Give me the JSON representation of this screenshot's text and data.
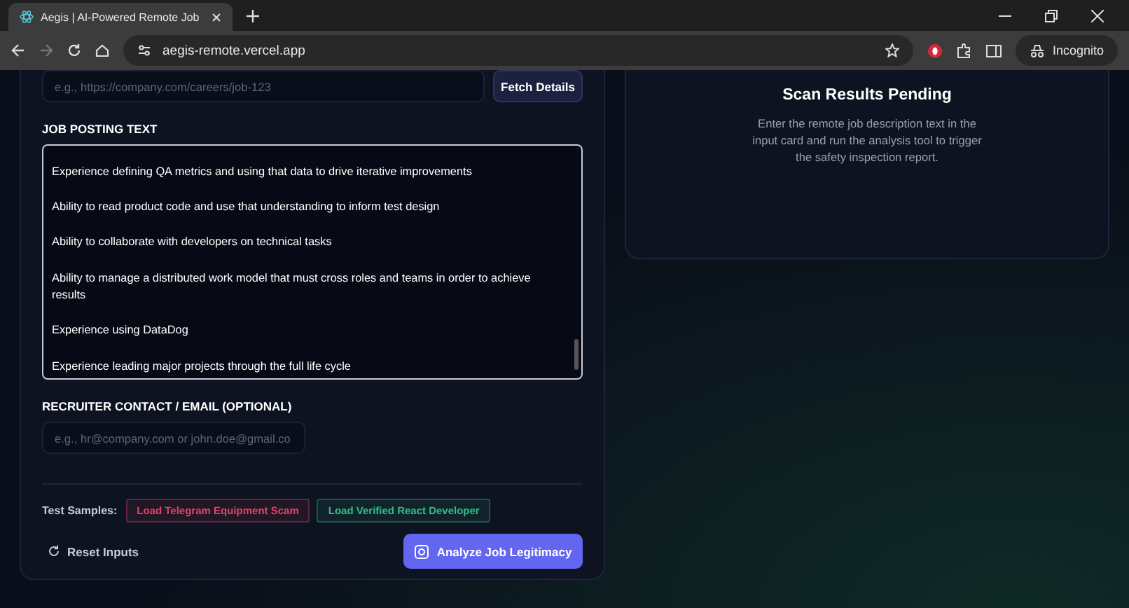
{
  "browser": {
    "tab_title": "Aegis | AI-Powered Remote Job",
    "address": "aegis-remote.vercel.app",
    "profile": "Incognito"
  },
  "input_card": {
    "url_field": {
      "placeholder": "e.g., https://company.com/careers/job-123"
    },
    "fetch_button": "Fetch Details",
    "posting_label": "JOB POSTING TEXT",
    "posting_text": "Experience defining QA metrics and using that data to drive iterative improvements\n\nAbility to read product code and use that understanding to inform test design\n\nAbility to collaborate with developers on technical tasks\n\nAbility to manage a distributed work model that must cross roles and teams in order to achieve results\n\nExperience using DataDog\n\nExperience leading major projects through the full life cycle",
    "contact_label": "RECRUITER CONTACT / EMAIL (OPTIONAL)",
    "contact_field": {
      "placeholder": "e.g., hr@company.com or john.doe@gmail.co"
    },
    "samples_label": "Test Samples:",
    "samples": [
      {
        "label": "Load Telegram Equipment Scam",
        "color": "#e0455f"
      },
      {
        "label": "Load Verified React Developer",
        "color": "#2fbf8a"
      }
    ],
    "reset_button": "Reset Inputs",
    "analyze_button": "Analyze Job Legitimacy"
  },
  "results_card": {
    "title": "Scan Results Pending",
    "message": "Enter the remote job description text in the input card and run the analysis tool to trigger the safety inspection report."
  }
}
